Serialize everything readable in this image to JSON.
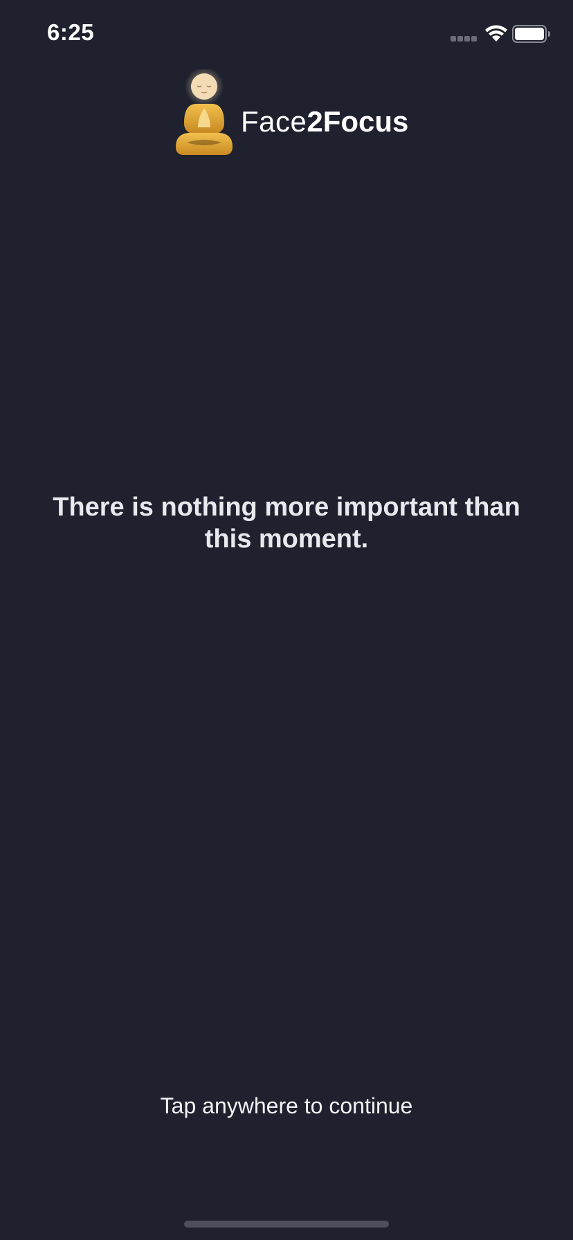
{
  "status_bar": {
    "time": "6:25",
    "signal_icon": "cellular-signal-icon",
    "wifi_icon": "wifi-icon",
    "battery_icon": "battery-icon"
  },
  "brand": {
    "logo_icon": "meditating-figure-logo-icon",
    "name_regular": "Face",
    "name_bold": "2Focus"
  },
  "main": {
    "quote": "There is nothing more important than this moment."
  },
  "footer": {
    "tap_hint": "Tap anywhere to continue"
  },
  "colors": {
    "background": "#1f222e",
    "logo_gold": "#e4a93a",
    "logo_face": "#f3dcb5",
    "text": "#e8e9ee"
  }
}
